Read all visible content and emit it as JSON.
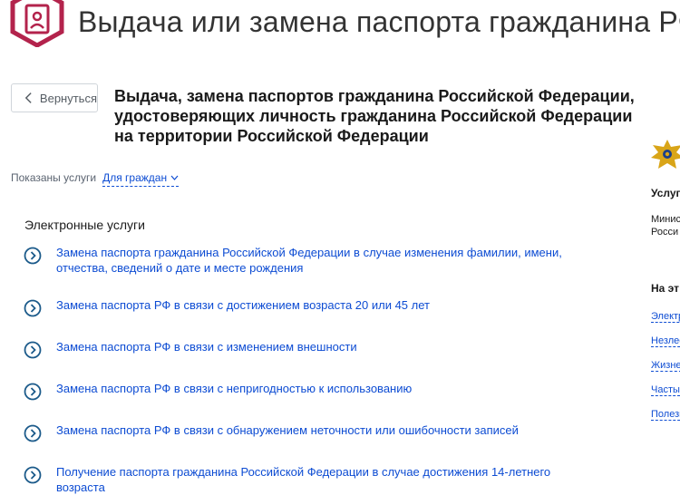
{
  "header": {
    "title": "Выдача или замена паспорта гражданина РФ",
    "icon": "passport-icon",
    "accent_color": "#b3234c"
  },
  "back_button": {
    "label": "Вернуться"
  },
  "service_title": "Выдача, замена паспортов гражданина Российской Федерации, удостоверяющих личность гражданина Российской Федерации на территории Российской Федерации",
  "filter": {
    "label": "Показаны услуги",
    "value": "Для граждан"
  },
  "section_heading": "Электронные услуги",
  "services": [
    {
      "label": "Замена паспорта гражданина Российской Федерации в случае изменения фамилии, имени, отчества, сведений о дате и месте рождения"
    },
    {
      "label": "Замена паспорта РФ в связи с достижением возраста 20 или 45 лет"
    },
    {
      "label": "Замена паспорта РФ в связи с изменением внешности"
    },
    {
      "label": "Замена паспорта РФ в связи с непригодностью к использованию"
    },
    {
      "label": "Замена паспорта РФ в связи с обнаружением неточности или ошибочности записей"
    },
    {
      "label": "Получение паспорта гражданина Российской Федерации в случае достижения 14-летнего возраста"
    }
  ],
  "right_panel": {
    "provider_heading": "Услуг",
    "provider_line1": "Минис",
    "provider_line2": "Росси",
    "nav_heading": "На эт",
    "links": [
      "Электр",
      "Незлео",
      "Жизне",
      "Часты",
      "Полезн"
    ]
  },
  "colors": {
    "link": "#0d4cd3",
    "text": "#1a1a1a",
    "muted": "#5a6370",
    "arrow": "#1b5a8a"
  }
}
